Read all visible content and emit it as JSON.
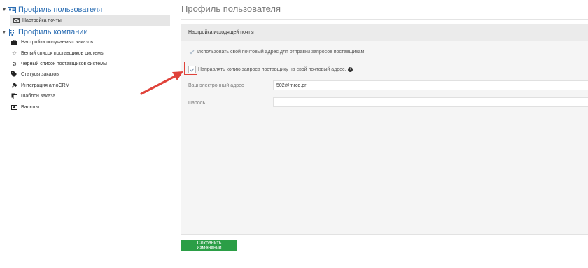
{
  "sidebar": {
    "user_profile": {
      "label": "Профиль пользователя",
      "icon": "id-card-icon"
    },
    "user_items": [
      {
        "label": "Настройка почты",
        "icon": "envelope-icon"
      }
    ],
    "company_profile": {
      "label": "Профиль компании",
      "icon": "building-icon"
    },
    "company_items": [
      {
        "label": "Настройки получаемых заказов",
        "icon": "briefcase-icon"
      },
      {
        "label": "Белый список поставщиков системы",
        "icon": "star-icon"
      },
      {
        "label": "Черный список поставщиков системы",
        "icon": "ban-icon"
      },
      {
        "label": "Статусы заказов",
        "icon": "tags-icon"
      },
      {
        "label": "Интеграция amoCRM",
        "icon": "plug-icon"
      },
      {
        "label": "Шаблон заказа",
        "icon": "copy-icon"
      },
      {
        "label": "Валюты",
        "icon": "money-icon"
      }
    ]
  },
  "main": {
    "title": "Профиль пользователя",
    "panel": {
      "heading": "Настройка исходящей почты",
      "use_own_email_label": "Использовать свой почтовый адрес для отправки запросов поставщикам",
      "send_copy_label": "Направлять копию запроса поставщику на свой почтовый адрес.",
      "email_label": "Ваш электронный адрес",
      "email_value": "502@mrcd.pr",
      "password_label": "Пароль",
      "password_value": ""
    },
    "save_button": "Сохранить изменения"
  },
  "colors": {
    "accent_blue": "#2a6db3",
    "save_green": "#2b9e46",
    "annotation_red": "#e0423a"
  }
}
